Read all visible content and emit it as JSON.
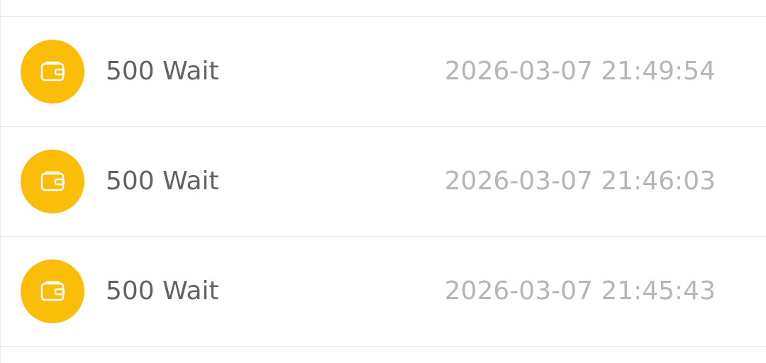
{
  "colors": {
    "accent": "#fbbd08",
    "title": "#606266",
    "timestamp": "#b6b6b6",
    "divider": "#e9e9e9",
    "background": "#ffffff"
  },
  "records": [
    {
      "icon": "wallet-icon",
      "title": "500 Wait",
      "timestamp": "2026-03-07 21:49:54"
    },
    {
      "icon": "wallet-icon",
      "title": "500 Wait",
      "timestamp": "2026-03-07 21:46:03"
    },
    {
      "icon": "wallet-icon",
      "title": "500 Wait",
      "timestamp": "2026-03-07 21:45:43"
    }
  ]
}
